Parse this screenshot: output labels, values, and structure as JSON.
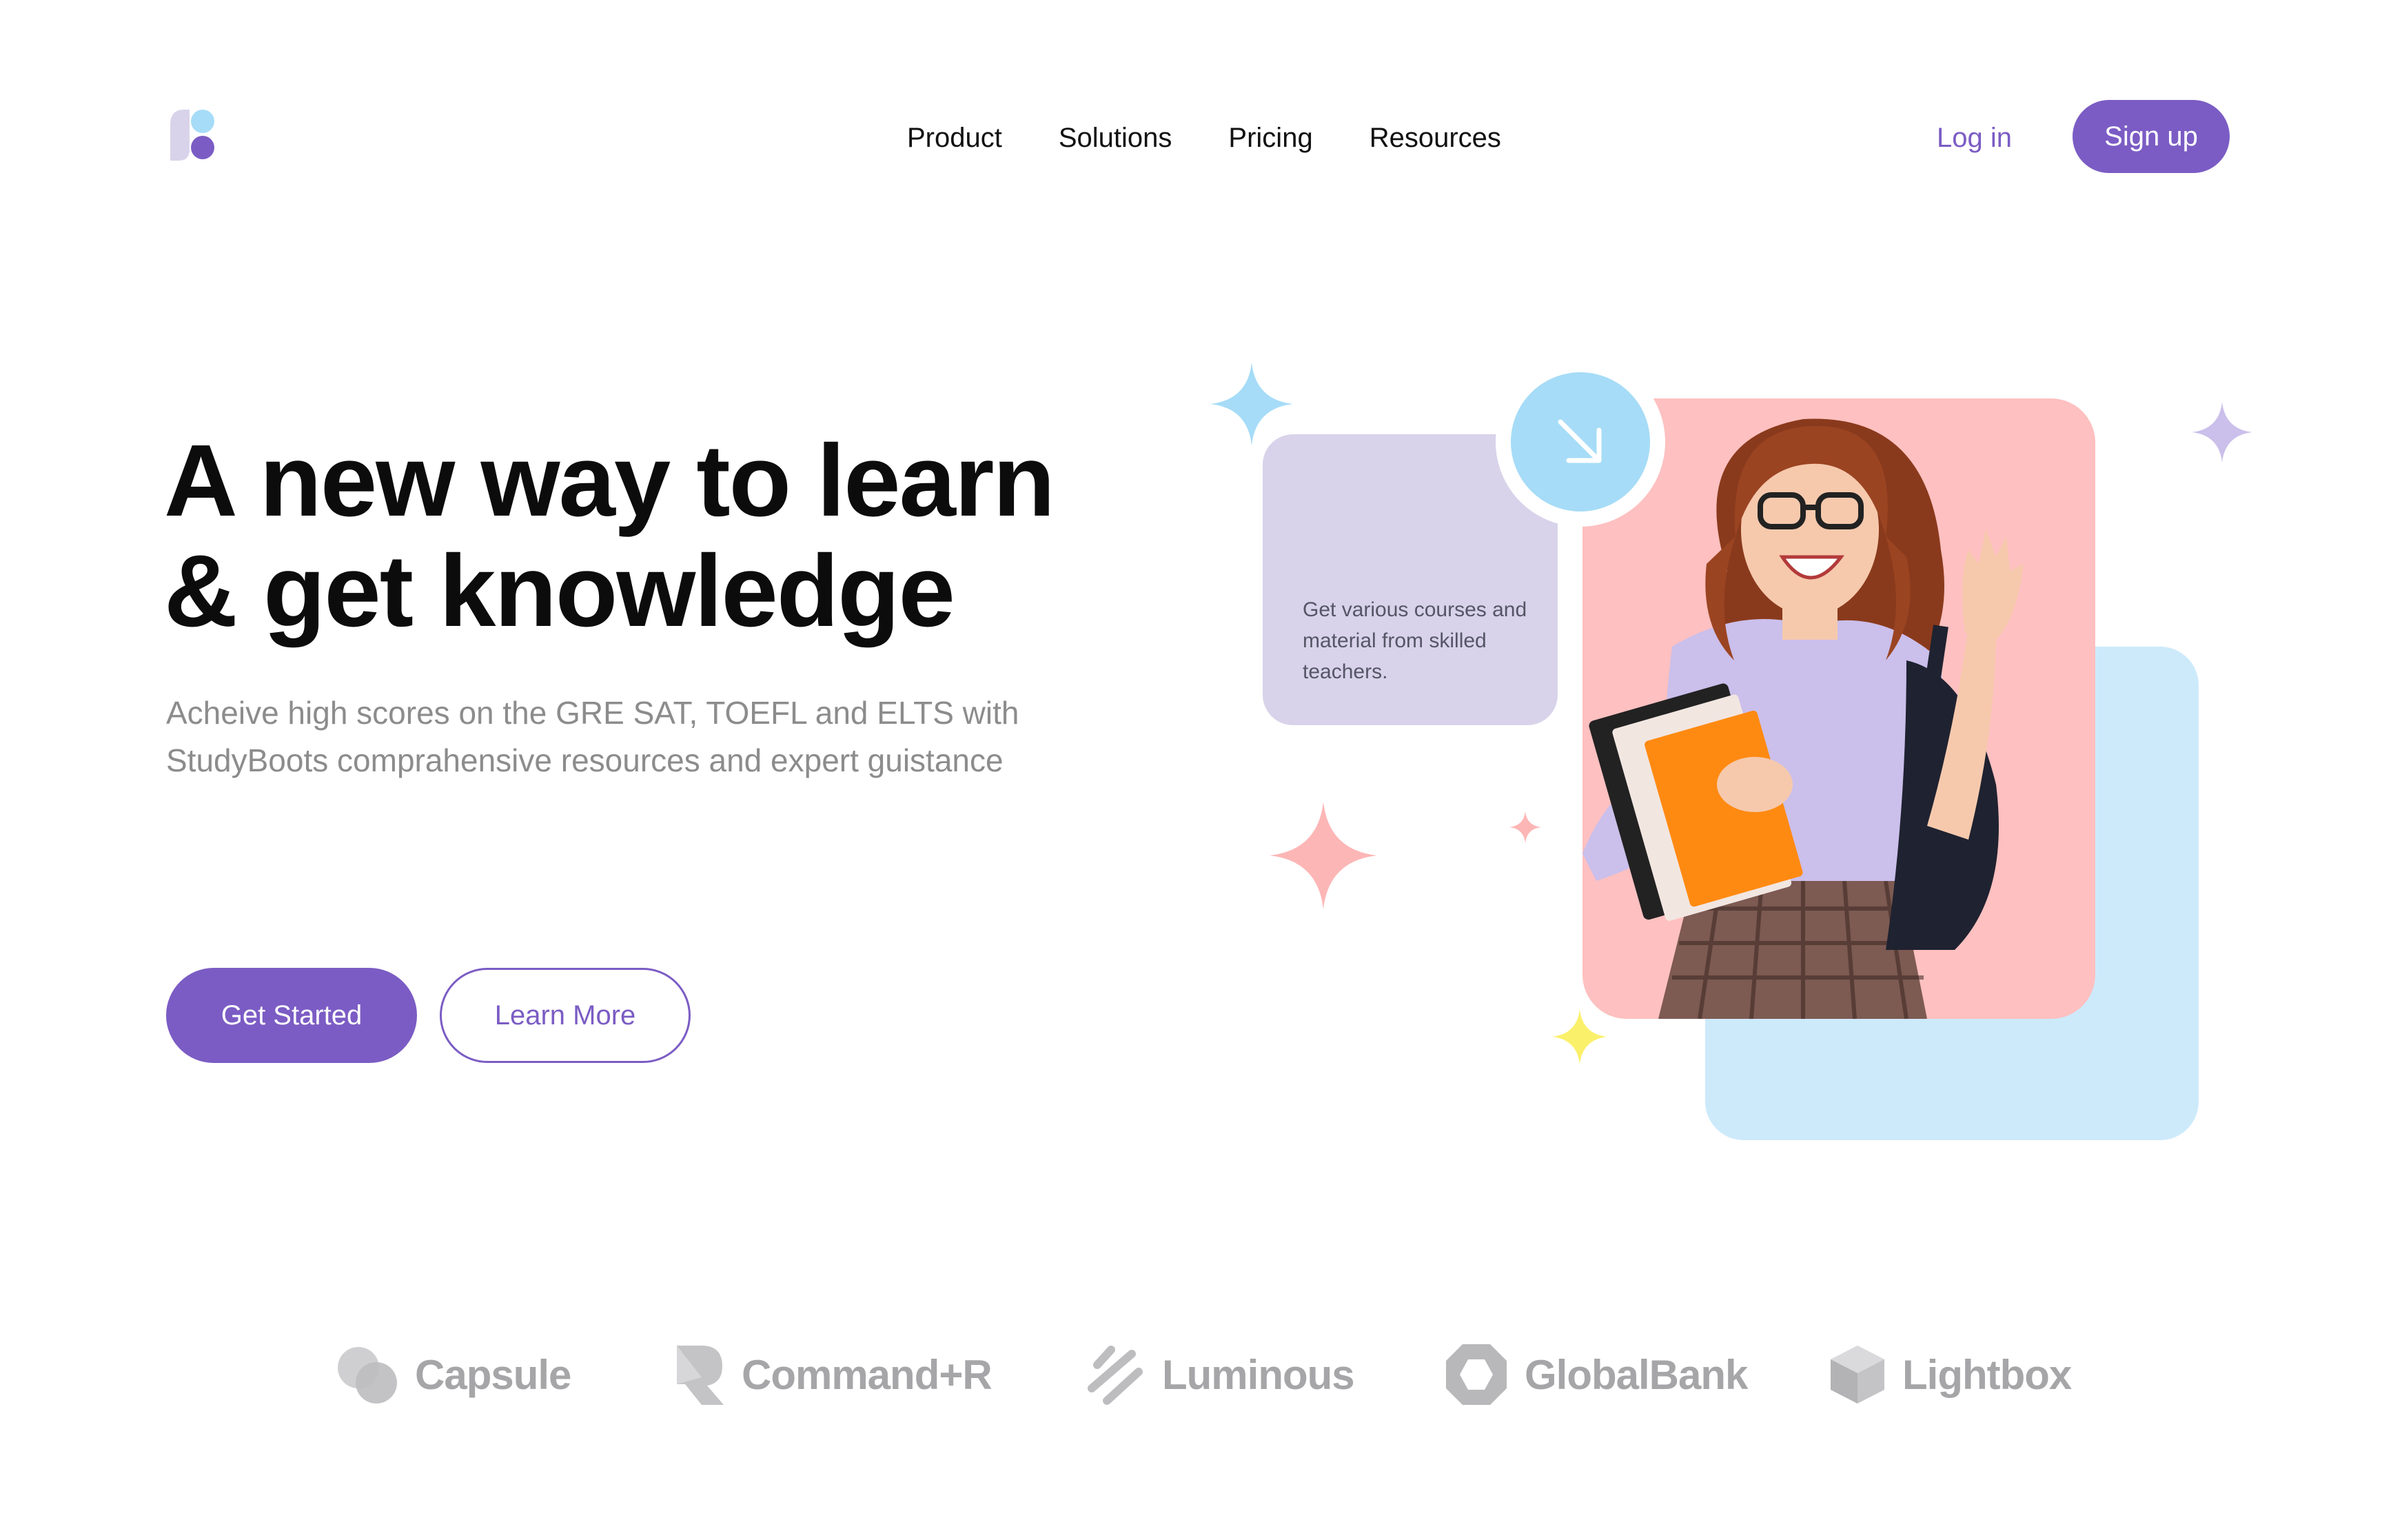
{
  "header": {
    "nav": [
      "Product",
      "Solutions",
      "Pricing",
      "Resources"
    ],
    "login_label": "Log in",
    "signup_label": "Sign up"
  },
  "hero": {
    "title_line1": "A new way to learn",
    "title_line2": "& get knowledge",
    "subtitle": "Acheive high scores on the GRE SAT, TOEFL and ELTS with StudyBoots comprahensive resources and expert guistance",
    "primary_cta": "Get Started",
    "secondary_cta": "Learn More",
    "card_text": "Get various courses and material from skilled teachers."
  },
  "brands": [
    "Capsule",
    "Command+R",
    "Luminous",
    "GlobalBank",
    "Lightbox"
  ],
  "colors": {
    "accent": "#7b5cc4",
    "card_pink": "#fec0c0",
    "card_blue": "#cdeafb",
    "card_lilac": "#d8d3ea",
    "circle_blue": "#a6dcf7"
  }
}
